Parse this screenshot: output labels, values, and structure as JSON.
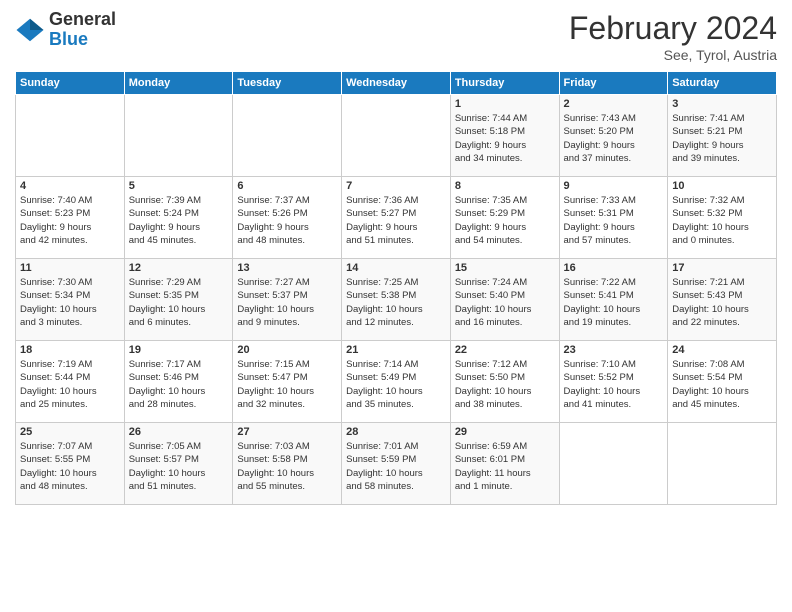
{
  "header": {
    "logo_general": "General",
    "logo_blue": "Blue",
    "month_title": "February 2024",
    "subtitle": "See, Tyrol, Austria"
  },
  "days_of_week": [
    "Sunday",
    "Monday",
    "Tuesday",
    "Wednesday",
    "Thursday",
    "Friday",
    "Saturday"
  ],
  "weeks": [
    {
      "days": [
        {
          "num": "",
          "info": ""
        },
        {
          "num": "",
          "info": ""
        },
        {
          "num": "",
          "info": ""
        },
        {
          "num": "",
          "info": ""
        },
        {
          "num": "1",
          "info": "Sunrise: 7:44 AM\nSunset: 5:18 PM\nDaylight: 9 hours\nand 34 minutes."
        },
        {
          "num": "2",
          "info": "Sunrise: 7:43 AM\nSunset: 5:20 PM\nDaylight: 9 hours\nand 37 minutes."
        },
        {
          "num": "3",
          "info": "Sunrise: 7:41 AM\nSunset: 5:21 PM\nDaylight: 9 hours\nand 39 minutes."
        }
      ]
    },
    {
      "days": [
        {
          "num": "4",
          "info": "Sunrise: 7:40 AM\nSunset: 5:23 PM\nDaylight: 9 hours\nand 42 minutes."
        },
        {
          "num": "5",
          "info": "Sunrise: 7:39 AM\nSunset: 5:24 PM\nDaylight: 9 hours\nand 45 minutes."
        },
        {
          "num": "6",
          "info": "Sunrise: 7:37 AM\nSunset: 5:26 PM\nDaylight: 9 hours\nand 48 minutes."
        },
        {
          "num": "7",
          "info": "Sunrise: 7:36 AM\nSunset: 5:27 PM\nDaylight: 9 hours\nand 51 minutes."
        },
        {
          "num": "8",
          "info": "Sunrise: 7:35 AM\nSunset: 5:29 PM\nDaylight: 9 hours\nand 54 minutes."
        },
        {
          "num": "9",
          "info": "Sunrise: 7:33 AM\nSunset: 5:31 PM\nDaylight: 9 hours\nand 57 minutes."
        },
        {
          "num": "10",
          "info": "Sunrise: 7:32 AM\nSunset: 5:32 PM\nDaylight: 10 hours\nand 0 minutes."
        }
      ]
    },
    {
      "days": [
        {
          "num": "11",
          "info": "Sunrise: 7:30 AM\nSunset: 5:34 PM\nDaylight: 10 hours\nand 3 minutes."
        },
        {
          "num": "12",
          "info": "Sunrise: 7:29 AM\nSunset: 5:35 PM\nDaylight: 10 hours\nand 6 minutes."
        },
        {
          "num": "13",
          "info": "Sunrise: 7:27 AM\nSunset: 5:37 PM\nDaylight: 10 hours\nand 9 minutes."
        },
        {
          "num": "14",
          "info": "Sunrise: 7:25 AM\nSunset: 5:38 PM\nDaylight: 10 hours\nand 12 minutes."
        },
        {
          "num": "15",
          "info": "Sunrise: 7:24 AM\nSunset: 5:40 PM\nDaylight: 10 hours\nand 16 minutes."
        },
        {
          "num": "16",
          "info": "Sunrise: 7:22 AM\nSunset: 5:41 PM\nDaylight: 10 hours\nand 19 minutes."
        },
        {
          "num": "17",
          "info": "Sunrise: 7:21 AM\nSunset: 5:43 PM\nDaylight: 10 hours\nand 22 minutes."
        }
      ]
    },
    {
      "days": [
        {
          "num": "18",
          "info": "Sunrise: 7:19 AM\nSunset: 5:44 PM\nDaylight: 10 hours\nand 25 minutes."
        },
        {
          "num": "19",
          "info": "Sunrise: 7:17 AM\nSunset: 5:46 PM\nDaylight: 10 hours\nand 28 minutes."
        },
        {
          "num": "20",
          "info": "Sunrise: 7:15 AM\nSunset: 5:47 PM\nDaylight: 10 hours\nand 32 minutes."
        },
        {
          "num": "21",
          "info": "Sunrise: 7:14 AM\nSunset: 5:49 PM\nDaylight: 10 hours\nand 35 minutes."
        },
        {
          "num": "22",
          "info": "Sunrise: 7:12 AM\nSunset: 5:50 PM\nDaylight: 10 hours\nand 38 minutes."
        },
        {
          "num": "23",
          "info": "Sunrise: 7:10 AM\nSunset: 5:52 PM\nDaylight: 10 hours\nand 41 minutes."
        },
        {
          "num": "24",
          "info": "Sunrise: 7:08 AM\nSunset: 5:54 PM\nDaylight: 10 hours\nand 45 minutes."
        }
      ]
    },
    {
      "days": [
        {
          "num": "25",
          "info": "Sunrise: 7:07 AM\nSunset: 5:55 PM\nDaylight: 10 hours\nand 48 minutes."
        },
        {
          "num": "26",
          "info": "Sunrise: 7:05 AM\nSunset: 5:57 PM\nDaylight: 10 hours\nand 51 minutes."
        },
        {
          "num": "27",
          "info": "Sunrise: 7:03 AM\nSunset: 5:58 PM\nDaylight: 10 hours\nand 55 minutes."
        },
        {
          "num": "28",
          "info": "Sunrise: 7:01 AM\nSunset: 5:59 PM\nDaylight: 10 hours\nand 58 minutes."
        },
        {
          "num": "29",
          "info": "Sunrise: 6:59 AM\nSunset: 6:01 PM\nDaylight: 11 hours\nand 1 minute."
        },
        {
          "num": "",
          "info": ""
        },
        {
          "num": "",
          "info": ""
        }
      ]
    }
  ]
}
